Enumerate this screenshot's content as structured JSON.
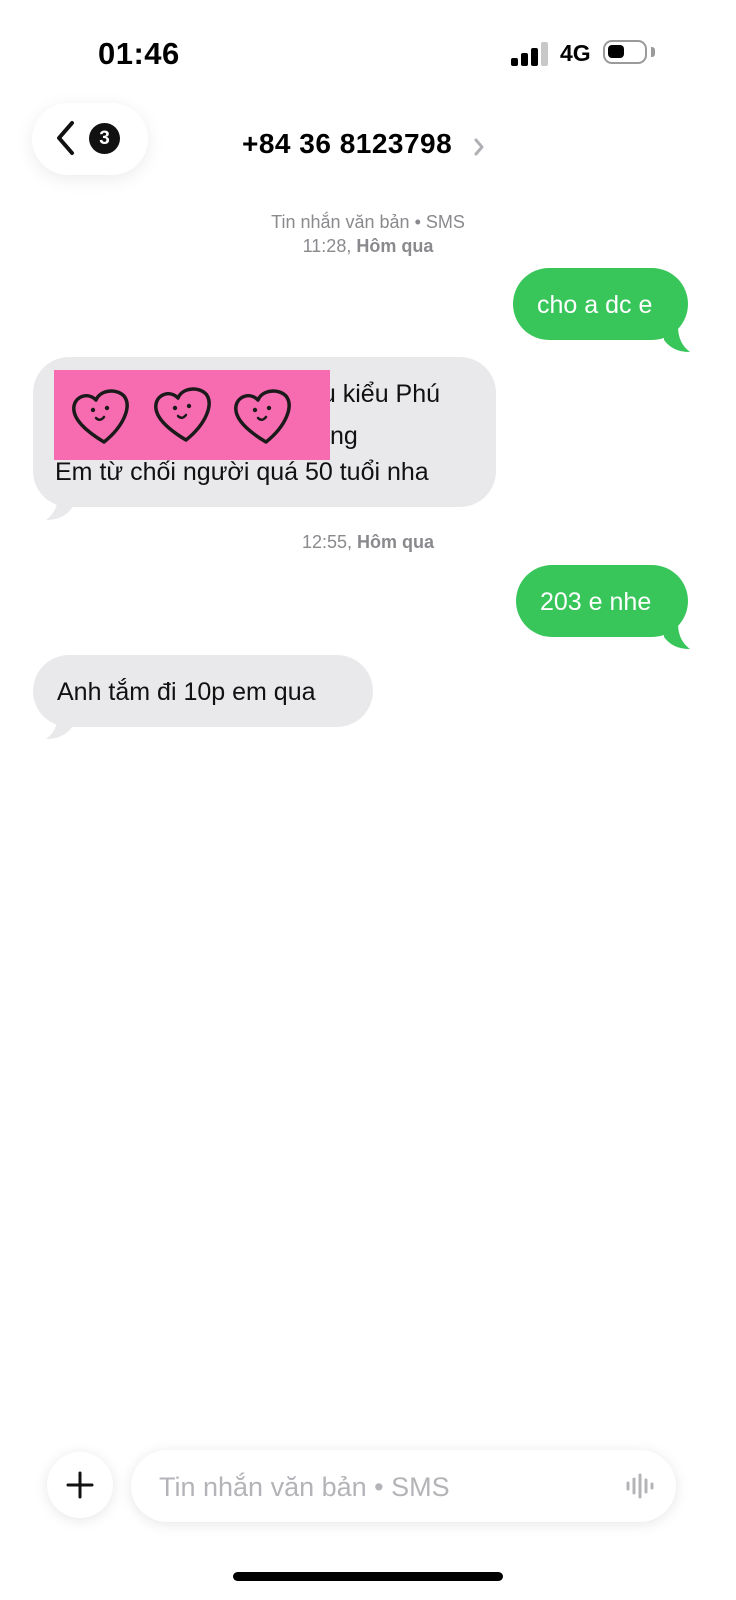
{
  "status_bar": {
    "time": "01:46",
    "network": "4G",
    "icons": [
      "signal-icon",
      "battery-icon"
    ]
  },
  "header": {
    "back_badge": "3",
    "contact": "+84 36 8123798",
    "icons": [
      "chevron-left-icon",
      "chevron-right-icon"
    ]
  },
  "thread": {
    "meta_1_line1": "Tin nhắn văn bản • SMS",
    "meta_1_time": "11:28,",
    "meta_1_day": "Hôm qua",
    "out_1": "cho a dc e",
    "in_1_line1": "ầu kiểu Phú",
    "in_1_line2": "ng",
    "in_1_line3": "Em từ chối người quá 50 tuổi nha",
    "meta_2_time": "12:55,",
    "meta_2_day": "Hôm qua",
    "out_2": "203 e nhe",
    "in_2": "Anh tắm đi 10p em qua",
    "sticker": "heart-faces-sticker"
  },
  "composer": {
    "placeholder": "Tin nhắn văn bản • SMS",
    "icons": [
      "plus-icon",
      "audio-waveform-icon"
    ]
  },
  "colors": {
    "outgoing_bubble": "#38c65a",
    "incoming_bubble": "#e9e9eb",
    "sticker_bg": "#f76cb0",
    "meta_text": "#8a8a8e"
  }
}
